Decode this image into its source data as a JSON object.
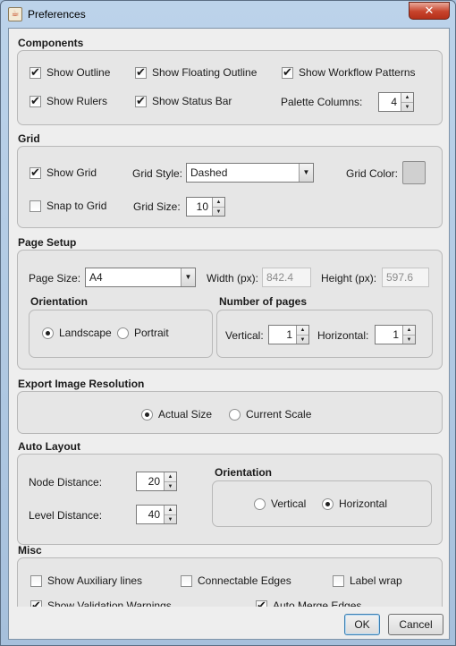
{
  "window": {
    "title": "Preferences",
    "close_glyph": "✕"
  },
  "components": {
    "title": "Components",
    "show_outline": {
      "label": "Show Outline",
      "checked": true
    },
    "show_floating_outline": {
      "label": "Show Floating Outline",
      "checked": true
    },
    "show_workflow_patterns": {
      "label": "Show Workflow Patterns",
      "checked": true
    },
    "show_rulers": {
      "label": "Show Rulers",
      "checked": true
    },
    "show_status_bar": {
      "label": "Show Status Bar",
      "checked": true
    },
    "palette_columns_label": "Palette Columns:",
    "palette_columns_value": "4"
  },
  "grid": {
    "title": "Grid",
    "show_grid": {
      "label": "Show Grid",
      "checked": true
    },
    "grid_style_label": "Grid Style:",
    "grid_style_value": "Dashed",
    "grid_color_label": "Grid Color:",
    "grid_color": "#d0d0d0",
    "snap_to_grid": {
      "label": "Snap to Grid",
      "checked": false
    },
    "grid_size_label": "Grid Size:",
    "grid_size_value": "10"
  },
  "page_setup": {
    "title": "Page Setup",
    "page_size_label": "Page Size:",
    "page_size_value": "A4",
    "width_label": "Width (px):",
    "width_value": "842.4",
    "height_label": "Height (px):",
    "height_value": "597.6",
    "orientation_title": "Orientation",
    "landscape_label": "Landscape",
    "portrait_label": "Portrait",
    "orientation_selected": "Landscape",
    "pages_title": "Number of pages",
    "vertical_label": "Vertical:",
    "vertical_value": "1",
    "horizontal_label": "Horizontal:",
    "horizontal_value": "1"
  },
  "export": {
    "title": "Export Image Resolution",
    "actual_size_label": "Actual Size",
    "current_scale_label": "Current Scale",
    "selected": "Actual Size"
  },
  "auto_layout": {
    "title": "Auto Layout",
    "node_distance_label": "Node Distance:",
    "node_distance_value": "20",
    "level_distance_label": "Level Distance:",
    "level_distance_value": "40",
    "orientation_title": "Orientation",
    "vertical_label": "Vertical",
    "horizontal_label": "Horizontal",
    "selected": "Horizontal"
  },
  "misc": {
    "title": "Misc",
    "show_auxiliary_lines": {
      "label": "Show Auxiliary lines",
      "checked": false
    },
    "connectable_edges": {
      "label": "Connectable Edges",
      "checked": false
    },
    "label_wrap": {
      "label": "Label wrap",
      "checked": false
    },
    "show_validation_warnings": {
      "label": "Show Validation Warnings",
      "checked": true
    },
    "auto_merge_edges": {
      "label": "Auto Merge Edges",
      "checked": true
    }
  },
  "buttons": {
    "ok": "OK",
    "cancel": "Cancel"
  },
  "spinner_up": "▲",
  "spinner_down": "▼",
  "combo_arrow": "▼"
}
